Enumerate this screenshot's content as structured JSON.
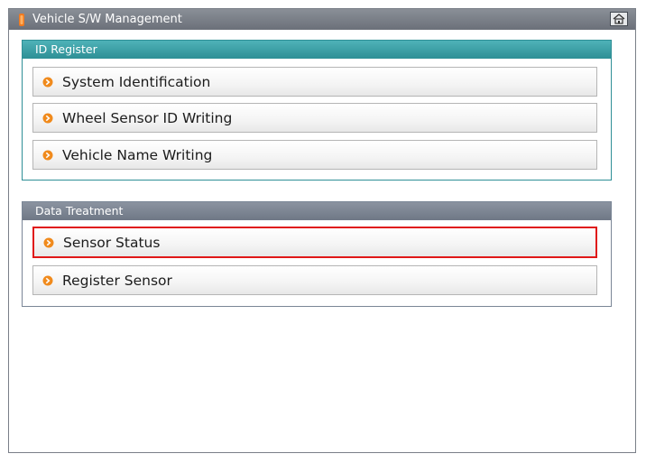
{
  "window": {
    "title": "Vehicle S/W Management"
  },
  "sections": {
    "id_register": {
      "header": "ID Register",
      "items": [
        {
          "label": "System Identification"
        },
        {
          "label": "Wheel Sensor ID Writing"
        },
        {
          "label": "Vehicle Name Writing"
        }
      ]
    },
    "data_treatment": {
      "header": "Data Treatment",
      "items": [
        {
          "label": "Sensor Status",
          "selected": true
        },
        {
          "label": "Register Sensor"
        }
      ]
    }
  },
  "colors": {
    "bullet": "#f08a1c",
    "selection_border": "#e01818",
    "id_header": "#2d8f95",
    "data_header": "#6f7886"
  }
}
